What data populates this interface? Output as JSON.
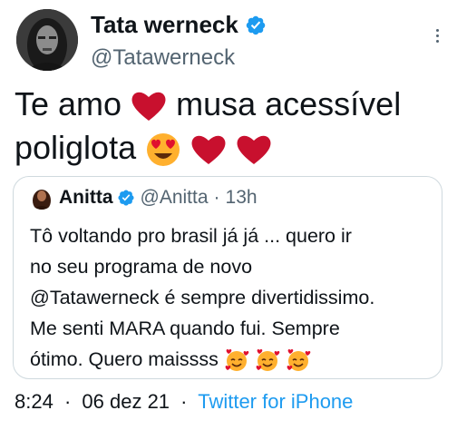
{
  "author": {
    "name": "Tata werneck",
    "handle": "@Tatawerneck"
  },
  "tweet": {
    "line1_start": "Te amo",
    "line1_end": "musa acessível",
    "line2": "poliglota"
  },
  "quoted": {
    "name": "Anitta",
    "handle": "@Anitta",
    "separator": "·",
    "time": "13h",
    "lines": [
      "Tô voltando pro brasil já já ... quero ir",
      "no seu programa de novo",
      "@Tatawerneck é sempre divertidissimo.",
      "Me senti MARA quando fui. Sempre",
      "ótimo. Quero maissss"
    ]
  },
  "footer": {
    "time": "8:24",
    "separator": "·",
    "date": "06 dez 21",
    "source": "Twitter for iPhone"
  },
  "colors": {
    "verified": "#1d9bf0",
    "link": "#1d9bf0",
    "secondary_text": "#536471",
    "heart": "#c8102e",
    "emoji_face": "#ffb02e"
  },
  "icons": [
    "verified-badge-icon",
    "more-options-icon",
    "red-heart-icon",
    "heart-eyes-emoji-icon",
    "smiling-face-with-hearts-icon"
  ]
}
